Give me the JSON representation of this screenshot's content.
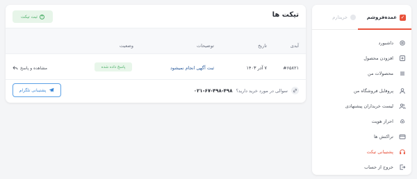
{
  "sidebar": {
    "role_seller": "عمده‌فروشم",
    "role_buyer": "خریدارم",
    "items": [
      {
        "label": "داشبورد",
        "icon": "gear-icon"
      },
      {
        "label": "افزودن محصول",
        "icon": "plus-square-icon"
      },
      {
        "label": "محصولات من",
        "icon": "list-icon"
      },
      {
        "label": "پروفایل فروشگاه من",
        "icon": "user-icon"
      },
      {
        "label": "لیست خریداران پیشنهادی",
        "icon": "users-icon"
      },
      {
        "label": "احراز هویت",
        "icon": "fingerprint-icon"
      },
      {
        "label": "تراکنش ها",
        "icon": "card-icon"
      },
      {
        "label": "پشتیبانی تیکت",
        "icon": "headset-icon"
      },
      {
        "label": "خروج از حساب",
        "icon": "logout-icon"
      }
    ],
    "active_index": 7
  },
  "main": {
    "title": "تیکت ها",
    "new_ticket_label": "ثبت تیکت",
    "columns": {
      "id": "آیدی",
      "date": "تاریخ",
      "description": "توضیحات",
      "status": "وضعیت"
    },
    "rows": [
      {
        "id": "#۶۵۸۲۱",
        "date": "۷ آذر ۱۴۰۳",
        "description": "ثبت آگهی انجام نمیشود",
        "status": "پاسخ داده شده",
        "action": "مشاهده و پاسخ"
      }
    ],
    "footer": {
      "question": "سوالی در مورد خرید دارید؟",
      "phone": "۰۲۱-۶۷-۴۹۸-۴۹۸",
      "telegram_label": "پشتیبانی تلگرام"
    }
  },
  "colors": {
    "accent": "#e8523b",
    "success": "#4caf68",
    "link": "#3b87d6"
  }
}
